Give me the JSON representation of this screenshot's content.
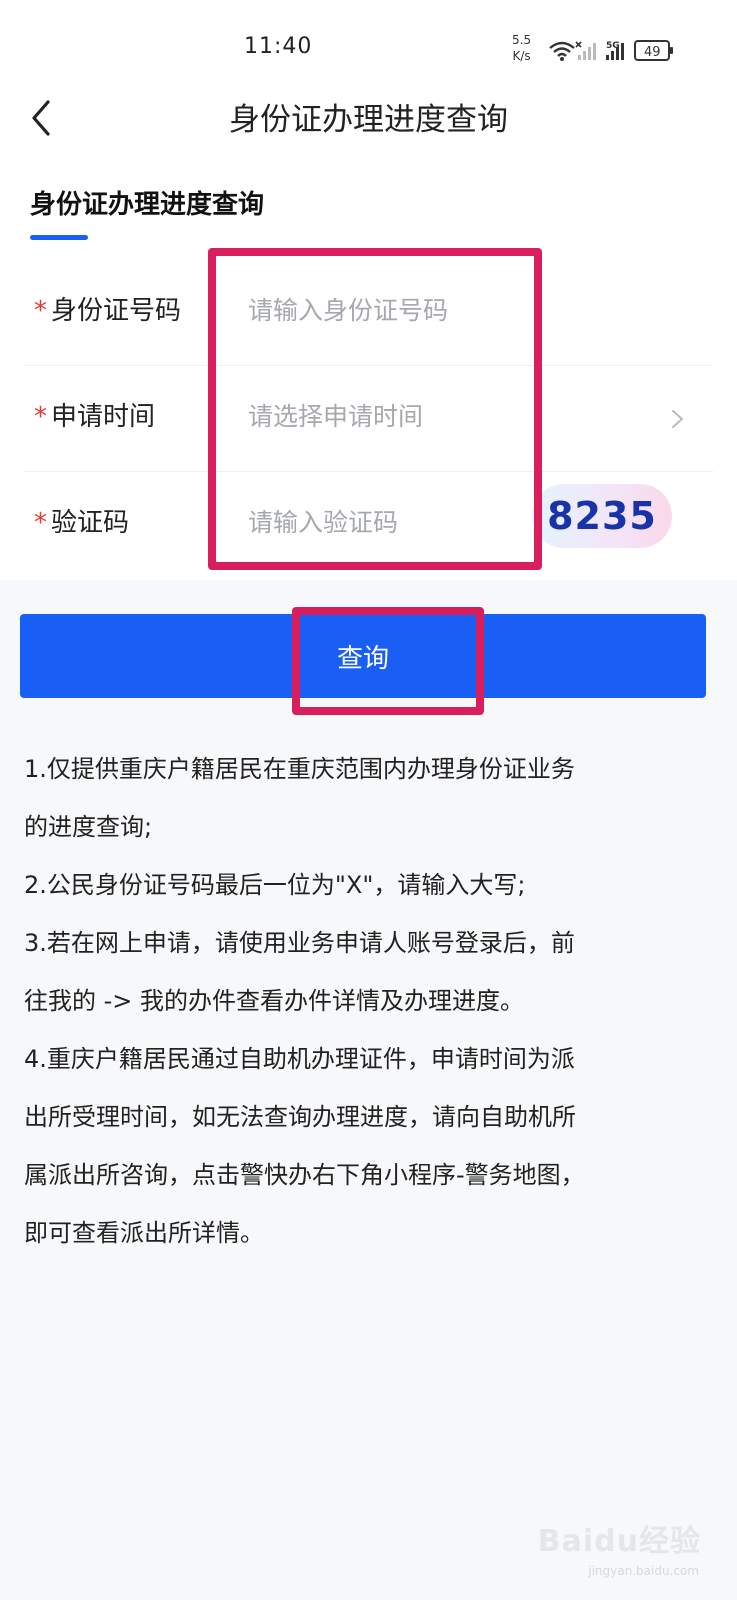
{
  "status_bar": {
    "time": "11:40",
    "net_speed_value": "5.5",
    "net_speed_unit": "K/s",
    "signal_label": "5G",
    "battery": "49"
  },
  "header": {
    "title": "身份证办理进度查询",
    "back_icon": "chevron-left-icon"
  },
  "section": {
    "title": "身份证办理进度查询",
    "accent_color": "#1a5ff5"
  },
  "form": {
    "required_mark": "*",
    "id_number": {
      "label": "身份证号码",
      "placeholder": "请输入身份证号码",
      "value": ""
    },
    "apply_date": {
      "label": "申请时间",
      "placeholder": "请选择申请时间",
      "value": ""
    },
    "captcha": {
      "label": "验证码",
      "placeholder": "请输入验证码",
      "value": "",
      "code": "8235"
    }
  },
  "query_button": {
    "label": "查询",
    "color": "#1a5ff5"
  },
  "highlight_color": "#d81e5b",
  "notes": [
    "1.仅提供重庆户籍居民在重庆范围内办理身份证业务",
    "的进度查询;",
    "2.公民身份证号码最后一位为\"X\"，请输入大写;",
    "3.若在网上申请，请使用业务申请人账号登录后，前",
    "往我的 -> 我的办件查看办件详情及办理进度。",
    "4.重庆户籍居民通过自助机办理证件，申请时间为派",
    "出所受理时间，如无法查询办理进度，请向自助机所",
    "属派出所咨询，点击警快办右下角小程序-警务地图，",
    "即可查看派出所详情。"
  ],
  "watermark": {
    "text": "Baidu经验",
    "sub": "jingyan.baidu.com"
  }
}
